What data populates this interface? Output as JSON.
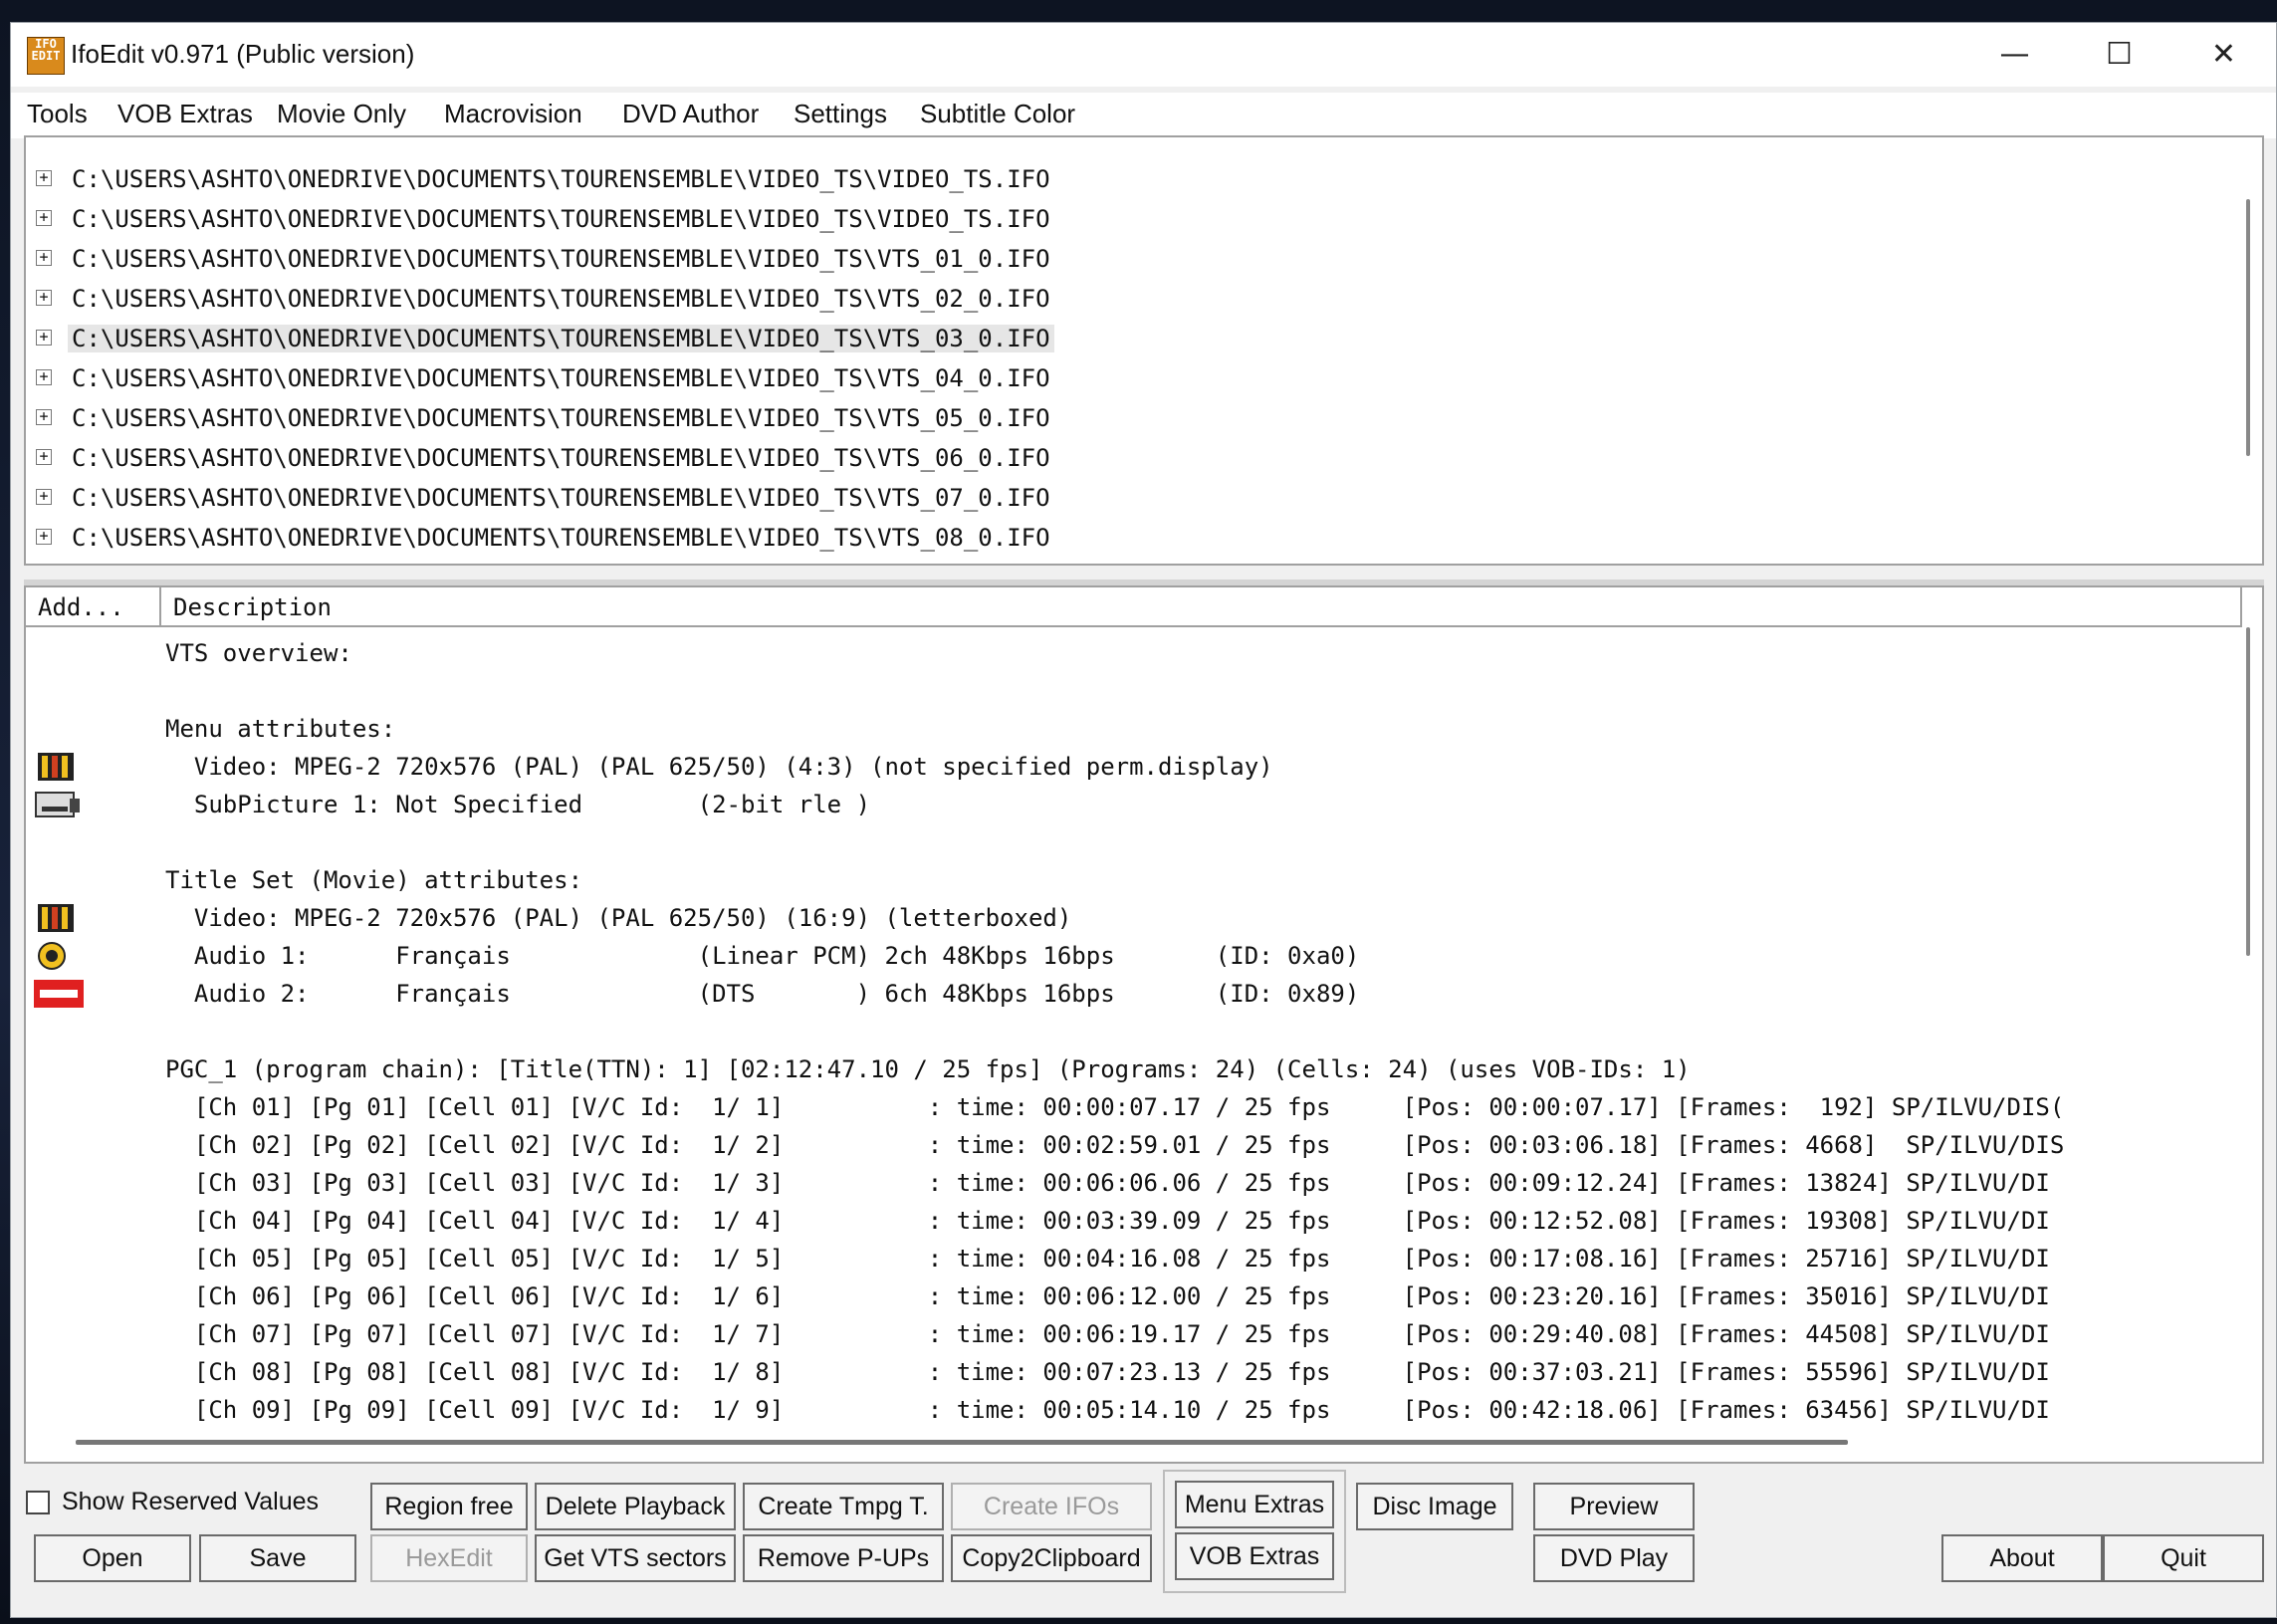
{
  "window": {
    "title": "IfoEdit v0.971 (Public version)",
    "icon_label": "IFO EDIT",
    "controls": {
      "minimize": "—",
      "maximize": "☐",
      "close": "✕"
    }
  },
  "menu": [
    "Tools",
    "VOB Extras",
    "Movie Only",
    "Macrovision",
    "DVD Author",
    "Settings",
    "Subtitle Color"
  ],
  "tree": {
    "selected_index": 4,
    "items": [
      "C:\\USERS\\ASHTO\\ONEDRIVE\\DOCUMENTS\\TOURENSEMBLE\\VIDEO_TS\\VIDEO_TS.IFO",
      "C:\\USERS\\ASHTO\\ONEDRIVE\\DOCUMENTS\\TOURENSEMBLE\\VIDEO_TS\\VIDEO_TS.IFO",
      "C:\\USERS\\ASHTO\\ONEDRIVE\\DOCUMENTS\\TOURENSEMBLE\\VIDEO_TS\\VTS_01_0.IFO",
      "C:\\USERS\\ASHTO\\ONEDRIVE\\DOCUMENTS\\TOURENSEMBLE\\VIDEO_TS\\VTS_02_0.IFO",
      "C:\\USERS\\ASHTO\\ONEDRIVE\\DOCUMENTS\\TOURENSEMBLE\\VIDEO_TS\\VTS_03_0.IFO",
      "C:\\USERS\\ASHTO\\ONEDRIVE\\DOCUMENTS\\TOURENSEMBLE\\VIDEO_TS\\VTS_04_0.IFO",
      "C:\\USERS\\ASHTO\\ONEDRIVE\\DOCUMENTS\\TOURENSEMBLE\\VIDEO_TS\\VTS_05_0.IFO",
      "C:\\USERS\\ASHTO\\ONEDRIVE\\DOCUMENTS\\TOURENSEMBLE\\VIDEO_TS\\VTS_06_0.IFO",
      "C:\\USERS\\ASHTO\\ONEDRIVE\\DOCUMENTS\\TOURENSEMBLE\\VIDEO_TS\\VTS_07_0.IFO",
      "C:\\USERS\\ASHTO\\ONEDRIVE\\DOCUMENTS\\TOURENSEMBLE\\VIDEO_TS\\VTS_08_0.IFO"
    ]
  },
  "details": {
    "columns": {
      "add": "Add...",
      "description": "Description"
    },
    "lines": [
      {
        "text": "VTS overview:",
        "icon": null
      },
      {
        "text": "",
        "icon": null
      },
      {
        "text": "Menu attributes:",
        "icon": null
      },
      {
        "text": "  Video: MPEG-2 720x576 (PAL) (PAL 625/50) (4:3) (not specified perm.display)",
        "icon": "film-icon"
      },
      {
        "text": "  SubPicture 1: Not Specified        (2-bit rle )",
        "icon": "subpicture-icon"
      },
      {
        "text": "",
        "icon": null
      },
      {
        "text": "Title Set (Movie) attributes:",
        "icon": null
      },
      {
        "text": "  Video: MPEG-2 720x576 (PAL) (PAL 625/50) (16:9) (letterboxed)",
        "icon": "film-icon"
      },
      {
        "text": "  Audio 1:      Français             (Linear PCM) 2ch 48Kbps 16bps       (ID: 0xa0)",
        "icon": "speaker-icon"
      },
      {
        "text": "  Audio 2:      Français             (DTS       ) 6ch 48Kbps 16bps       (ID: 0x89)",
        "icon": "dts-icon"
      },
      {
        "text": "",
        "icon": null
      },
      {
        "text": "PGC_1 (program chain): [Title(TTN): 1] [02:12:47.10 / 25 fps] (Programs: 24) (Cells: 24) (uses VOB-IDs: 1)",
        "icon": null
      },
      {
        "text": "  [Ch 01] [Pg 01] [Cell 01] [V/C Id:  1/ 1]          : time: 00:00:07.17 / 25 fps     [Pos: 00:00:07.17] [Frames:  192] SP/ILVU/DIS(",
        "icon": null
      },
      {
        "text": "  [Ch 02] [Pg 02] [Cell 02] [V/C Id:  1/ 2]          : time: 00:02:59.01 / 25 fps     [Pos: 00:03:06.18] [Frames: 4668]  SP/ILVU/DIS",
        "icon": null
      },
      {
        "text": "  [Ch 03] [Pg 03] [Cell 03] [V/C Id:  1/ 3]          : time: 00:06:06.06 / 25 fps     [Pos: 00:09:12.24] [Frames: 13824] SP/ILVU/DI",
        "icon": null
      },
      {
        "text": "  [Ch 04] [Pg 04] [Cell 04] [V/C Id:  1/ 4]          : time: 00:03:39.09 / 25 fps     [Pos: 00:12:52.08] [Frames: 19308] SP/ILVU/DI",
        "icon": null
      },
      {
        "text": "  [Ch 05] [Pg 05] [Cell 05] [V/C Id:  1/ 5]          : time: 00:04:16.08 / 25 fps     [Pos: 00:17:08.16] [Frames: 25716] SP/ILVU/DI",
        "icon": null
      },
      {
        "text": "  [Ch 06] [Pg 06] [Cell 06] [V/C Id:  1/ 6]          : time: 00:06:12.00 / 25 fps     [Pos: 00:23:20.16] [Frames: 35016] SP/ILVU/DI",
        "icon": null
      },
      {
        "text": "  [Ch 07] [Pg 07] [Cell 07] [V/C Id:  1/ 7]          : time: 00:06:19.17 / 25 fps     [Pos: 00:29:40.08] [Frames: 44508] SP/ILVU/DI",
        "icon": null
      },
      {
        "text": "  [Ch 08] [Pg 08] [Cell 08] [V/C Id:  1/ 8]          : time: 00:07:23.13 / 25 fps     [Pos: 00:37:03.21] [Frames: 55596] SP/ILVU/DI",
        "icon": null
      },
      {
        "text": "  [Ch 09] [Pg 09] [Cell 09] [V/C Id:  1/ 9]          : time: 00:05:14.10 / 25 fps     [Pos: 00:42:18.06] [Frames: 63456] SP/ILVU/DI",
        "icon": null
      }
    ]
  },
  "bottom": {
    "show_reserved_label": "Show Reserved Values",
    "show_reserved_checked": false,
    "buttons": {
      "open": "Open",
      "save": "Save",
      "region_free": "Region free",
      "hexedit": "HexEdit",
      "delete_playback": "Delete Playback",
      "get_vts_sectors": "Get VTS sectors",
      "create_tmpg": "Create Tmpg T.",
      "remove_pups": "Remove P-UPs",
      "create_ifos": "Create IFOs",
      "copy2clipboard": "Copy2Clipboard",
      "menu_extras": "Menu Extras",
      "vob_extras": "VOB Extras",
      "disc_image": "Disc Image",
      "preview": "Preview",
      "dvd_play": "DVD Play",
      "about": "About",
      "quit": "Quit"
    }
  }
}
